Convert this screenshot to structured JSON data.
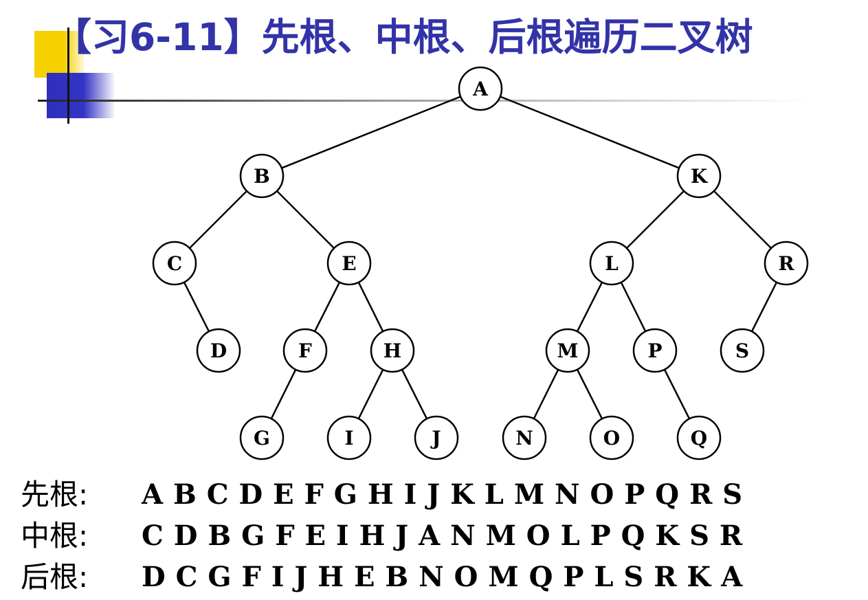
{
  "title": "【习6-11】先根、中根、后根遍历二叉树",
  "tree": {
    "nodes": [
      {
        "id": "A",
        "label": "A"
      },
      {
        "id": "B",
        "label": "B",
        "parent": "A"
      },
      {
        "id": "K",
        "label": "K",
        "parent": "A"
      },
      {
        "id": "C",
        "label": "C",
        "parent": "B"
      },
      {
        "id": "E",
        "label": "E",
        "parent": "B"
      },
      {
        "id": "L",
        "label": "L",
        "parent": "K"
      },
      {
        "id": "R",
        "label": "R",
        "parent": "K"
      },
      {
        "id": "D",
        "label": "D",
        "parent": "C"
      },
      {
        "id": "F",
        "label": "F",
        "parent": "E"
      },
      {
        "id": "H",
        "label": "H",
        "parent": "E"
      },
      {
        "id": "M",
        "label": "M",
        "parent": "L"
      },
      {
        "id": "P",
        "label": "P",
        "parent": "L"
      },
      {
        "id": "S",
        "label": "S",
        "parent": "R"
      },
      {
        "id": "G",
        "label": "G",
        "parent": "F"
      },
      {
        "id": "I",
        "label": "I",
        "parent": "H"
      },
      {
        "id": "J",
        "label": "J",
        "parent": "H"
      },
      {
        "id": "N",
        "label": "N",
        "parent": "M"
      },
      {
        "id": "O",
        "label": "O",
        "parent": "M"
      },
      {
        "id": "Q",
        "label": "Q",
        "parent": "P"
      }
    ]
  },
  "traversals": [
    {
      "label": "先根:",
      "sequence": "A B C D E F G H I J K L M N O P Q R S"
    },
    {
      "label": "中根:",
      "sequence": "C D B G F E I H J A N M O L P Q K S R"
    },
    {
      "label": "后根:",
      "sequence": "D C G F I J H E B N O M Q P L S R K A"
    }
  ],
  "colors": {
    "title": "#3333a8",
    "accent_yellow": "#f7d000",
    "accent_blue": "#3434c4",
    "node_stroke": "#000000",
    "node_fill": "#ffffff"
  }
}
